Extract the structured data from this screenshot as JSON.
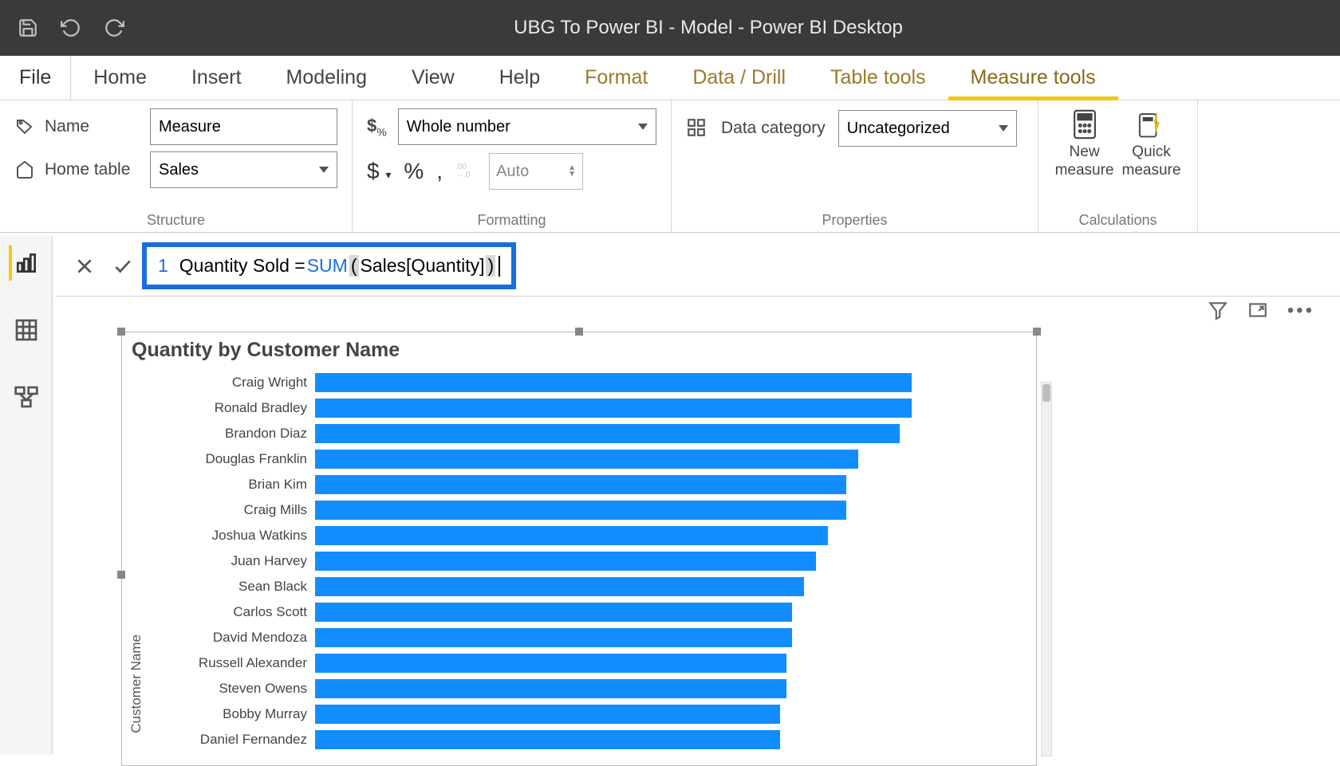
{
  "window": {
    "title": "UBG To Power BI - Model - Power BI Desktop"
  },
  "ribbon_tabs": {
    "file": "File",
    "home": "Home",
    "insert": "Insert",
    "modeling": "Modeling",
    "view": "View",
    "help": "Help",
    "format": "Format",
    "data_drill": "Data / Drill",
    "table_tools": "Table tools",
    "measure_tools": "Measure tools"
  },
  "structure": {
    "name_label": "Name",
    "name_value": "Measure",
    "table_label": "Home table",
    "table_value": "Sales",
    "group_label": "Structure"
  },
  "formatting": {
    "format_value": "Whole number",
    "decimals_placeholder": "Auto",
    "group_label": "Formatting"
  },
  "properties": {
    "category_label": "Data category",
    "category_value": "Uncategorized",
    "group_label": "Properties"
  },
  "calculations": {
    "new_measure_l1": "New",
    "new_measure_l2": "measure",
    "quick_measure_l1": "Quick",
    "quick_measure_l2": "measure",
    "group_label": "Calculations"
  },
  "formula": {
    "line_no": "1",
    "prefix": "Quantity Sold = ",
    "func": "SUM",
    "open_paren": "(",
    "arg": " Sales[Quantity] ",
    "close_paren": ")"
  },
  "chart_data": {
    "type": "bar",
    "title": "Quantity by Customer Name",
    "ylabel": "Customer Name",
    "categories": [
      "Craig Wright",
      "Ronald Bradley",
      "Brandon Diaz",
      "Douglas Franklin",
      "Brian Kim",
      "Craig Mills",
      "Joshua Watkins",
      "Juan Harvey",
      "Sean Black",
      "Carlos Scott",
      "David Mendoza",
      "Russell Alexander",
      "Steven Owens",
      "Bobby Murray",
      "Daniel Fernandez"
    ],
    "values": [
      100,
      100,
      98,
      91,
      89,
      89,
      86,
      84,
      82,
      80,
      80,
      79,
      79,
      78,
      78
    ]
  }
}
